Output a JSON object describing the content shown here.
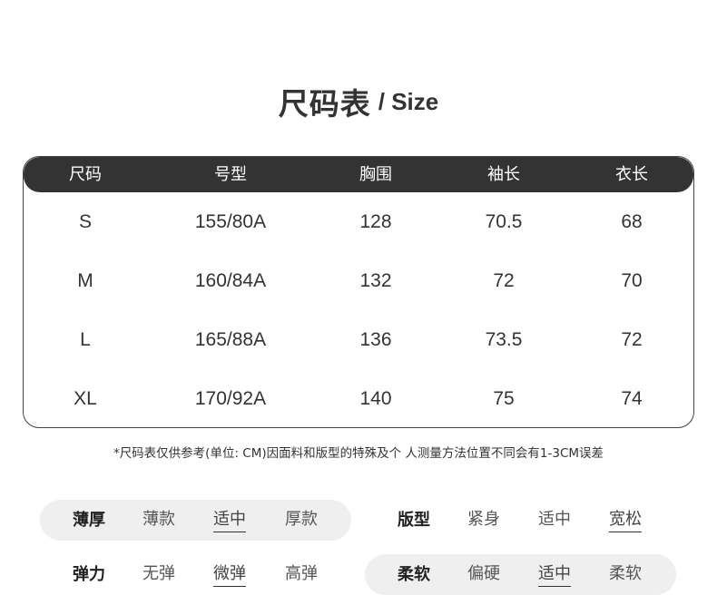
{
  "title": {
    "cn": "尺码表",
    "en": "/ Size"
  },
  "table": {
    "headers": [
      "尺码",
      "号型",
      "胸围",
      "袖长",
      "衣长"
    ],
    "rows": [
      [
        "S",
        "155/80A",
        "128",
        "70.5",
        "68"
      ],
      [
        "M",
        "160/84A",
        "132",
        "72",
        "70"
      ],
      [
        "L",
        "165/88A",
        "136",
        "73.5",
        "72"
      ],
      [
        "XL",
        "170/92A",
        "140",
        "75",
        "74"
      ]
    ]
  },
  "note": "*尺码表仅供参考(单位: CM)因面料和版型的特殊及个 人测量方法位置不同会有1-3CM误差",
  "attributes": {
    "thickness": {
      "label": "薄厚",
      "options": [
        "薄款",
        "适中",
        "厚款"
      ],
      "selected": "适中"
    },
    "fit": {
      "label": "版型",
      "options": [
        "紧身",
        "适中",
        "宽松"
      ],
      "selected": "宽松"
    },
    "elasticity": {
      "label": "弹力",
      "options": [
        "无弹",
        "微弹",
        "高弹"
      ],
      "selected": "微弹"
    },
    "softness": {
      "label": "柔软",
      "options": [
        "偏硬",
        "适中",
        "柔软"
      ],
      "selected": "适中"
    }
  }
}
